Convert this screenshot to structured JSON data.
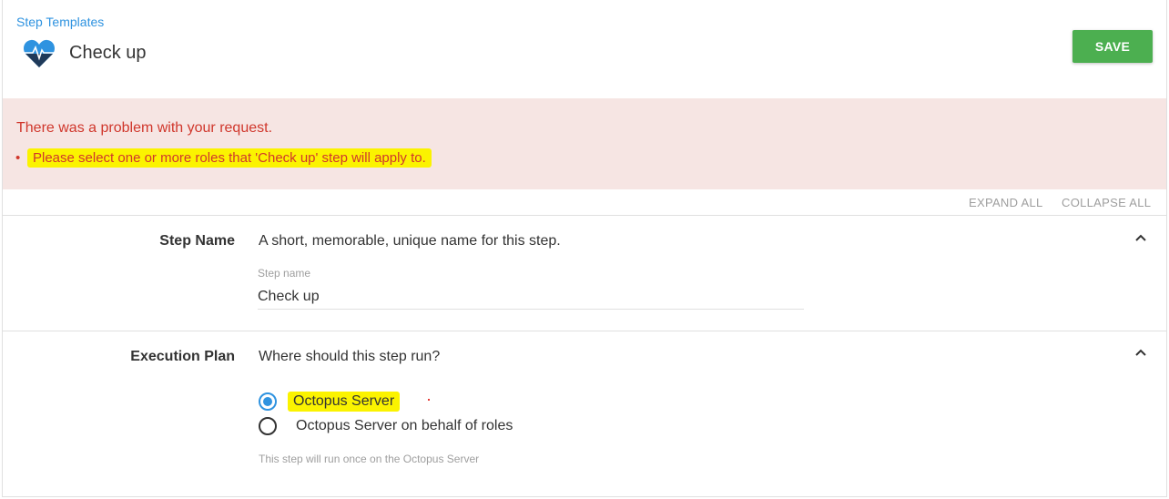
{
  "header": {
    "breadcrumb": "Step Templates",
    "title": "Check up",
    "title_icon": "heart-pulse-icon",
    "save_label": "SAVE"
  },
  "error": {
    "title": "There was a problem with your request.",
    "items": [
      "Please select one or more roles that 'Check up' step will apply to."
    ]
  },
  "toolbar": {
    "expand_all": "EXPAND ALL",
    "collapse_all": "COLLAPSE ALL"
  },
  "sections": {
    "step_name": {
      "label": "Step Name",
      "description": "A short, memorable, unique name for this step.",
      "field_label": "Step name",
      "field_value": "Check up"
    },
    "execution_plan": {
      "label": "Execution Plan",
      "description": "Where should this step run?",
      "options": [
        "Octopus Server",
        "Octopus Server on behalf of roles"
      ],
      "selected_index": 0,
      "hint": "This step will run once on the Octopus Server"
    }
  },
  "colors": {
    "accent": "#2f93e0",
    "save": "#4caf50",
    "error_text": "#d0372c",
    "error_bg": "#f6e5e3",
    "highlight": "#fbf300"
  }
}
